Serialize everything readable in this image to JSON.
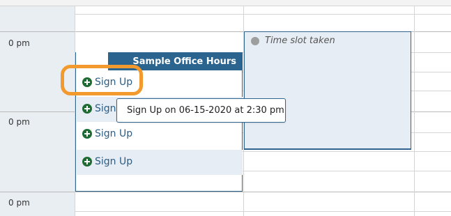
{
  "time_labels": [
    "0 pm",
    "0 pm",
    "0 pm"
  ],
  "office_hours": {
    "title": "Sample Office Hours",
    "slots": [
      {
        "label": "Sign Up"
      },
      {
        "label": "Sign Up"
      },
      {
        "label": "Sign Up"
      },
      {
        "label": "Sign Up"
      }
    ]
  },
  "taken_slot": {
    "label": "Time slot taken"
  },
  "tooltip": {
    "text": "Sign Up on 06-15-2020 at 2:30 pm"
  },
  "colors": {
    "header_blue": "#2a648f",
    "signup_green": "#1f6b34",
    "highlight_orange": "#f29a2e",
    "slot_shade": "#e7edf4"
  },
  "icons": {
    "signup": "plus-circle-icon",
    "taken": "gray-dot-icon"
  }
}
